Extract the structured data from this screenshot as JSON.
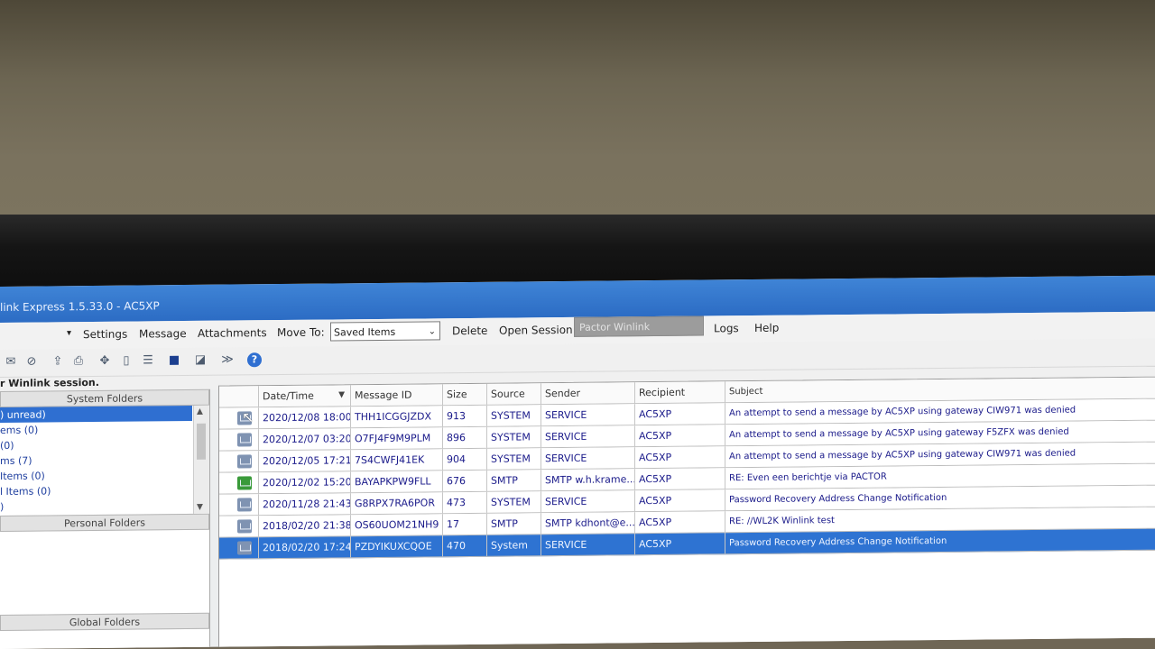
{
  "window": {
    "title": "link Express 1.5.33.0 - AC5XP"
  },
  "menu": {
    "dropdown_marker": "▾",
    "items": [
      "Settings",
      "Message",
      "Attachments"
    ],
    "move_to_label": "Move To:",
    "move_to_value": "Saved Items",
    "delete_label": "Delete",
    "open_session_label": "Open Session:",
    "session_value": "Pactor Winlink",
    "logs_label": "Logs",
    "help_label": "Help"
  },
  "toolbar": {
    "icons": [
      "mail-icon",
      "mail-check-icon",
      "export-icon",
      "print-icon",
      "move-icon",
      "trash-icon",
      "sort-icon",
      "save-icon",
      "print-preview-icon",
      "forward-icon",
      "help-icon"
    ]
  },
  "status": {
    "text": "r Winlink session."
  },
  "left_pane": {
    "system_header": "System Folders",
    "system_items": [
      ") unread)",
      "ems  (0)",
      "(0)",
      "ms  (7)",
      "Items  (0)",
      "l Items  (0)",
      ")"
    ],
    "personal_header": "Personal Folders",
    "global_header": "Global Folders"
  },
  "table": {
    "headers": [
      "Date/Time",
      "Message ID",
      "Size",
      "Source",
      "Sender",
      "Recipient",
      "Subject"
    ],
    "rows": [
      {
        "date": "2020/12/08 18:00",
        "id": "THH1ICGGJZDX",
        "size": "913",
        "source": "SYSTEM",
        "sender": "SERVICE",
        "recipient": "AC5XP",
        "subject": "An attempt to send a message by AC5XP using gateway CIW971 was denied",
        "icon": "envelope-icon"
      },
      {
        "date": "2020/12/07 03:20",
        "id": "O7FJ4F9M9PLM",
        "size": "896",
        "source": "SYSTEM",
        "sender": "SERVICE",
        "recipient": "AC5XP",
        "subject": "An attempt to send a message by AC5XP using gateway F5ZFX was denied",
        "icon": "envelope-icon"
      },
      {
        "date": "2020/12/05 17:21",
        "id": "7S4CWFJ41EK",
        "size": "904",
        "source": "SYSTEM",
        "sender": "SERVICE",
        "recipient": "AC5XP",
        "subject": "An attempt to send a message by AC5XP using gateway CIW971 was denied",
        "icon": "envelope-icon"
      },
      {
        "date": "2020/12/02 15:20",
        "id": "BAYAPKPW9FLL",
        "size": "676",
        "source": "SMTP",
        "sender": "SMTP w.h.krame...",
        "recipient": "AC5XP",
        "subject": "RE: Even een berichtje via PACTOR",
        "icon": "envelope-green-icon"
      },
      {
        "date": "2020/11/28 21:43",
        "id": "G8RPX7RA6POR",
        "size": "473",
        "source": "SYSTEM",
        "sender": "SERVICE",
        "recipient": "AC5XP",
        "subject": "Password Recovery Address Change Notification",
        "icon": "envelope-icon"
      },
      {
        "date": "2018/02/20 21:38",
        "id": "OS60UOM21NH9",
        "size": "17",
        "source": "SMTP",
        "sender": "SMTP kdhont@e...",
        "recipient": "AC5XP",
        "subject": "RE: //WL2K Winlink test",
        "icon": "envelope-icon"
      },
      {
        "date": "2018/02/20 17:24",
        "id": "PZDYIKUXCQOE",
        "size": "470",
        "source": "System",
        "sender": "SERVICE",
        "recipient": "AC5XP",
        "subject": "Password Recovery Address Change Notification",
        "icon": "envelope-icon",
        "selected": true
      }
    ]
  }
}
